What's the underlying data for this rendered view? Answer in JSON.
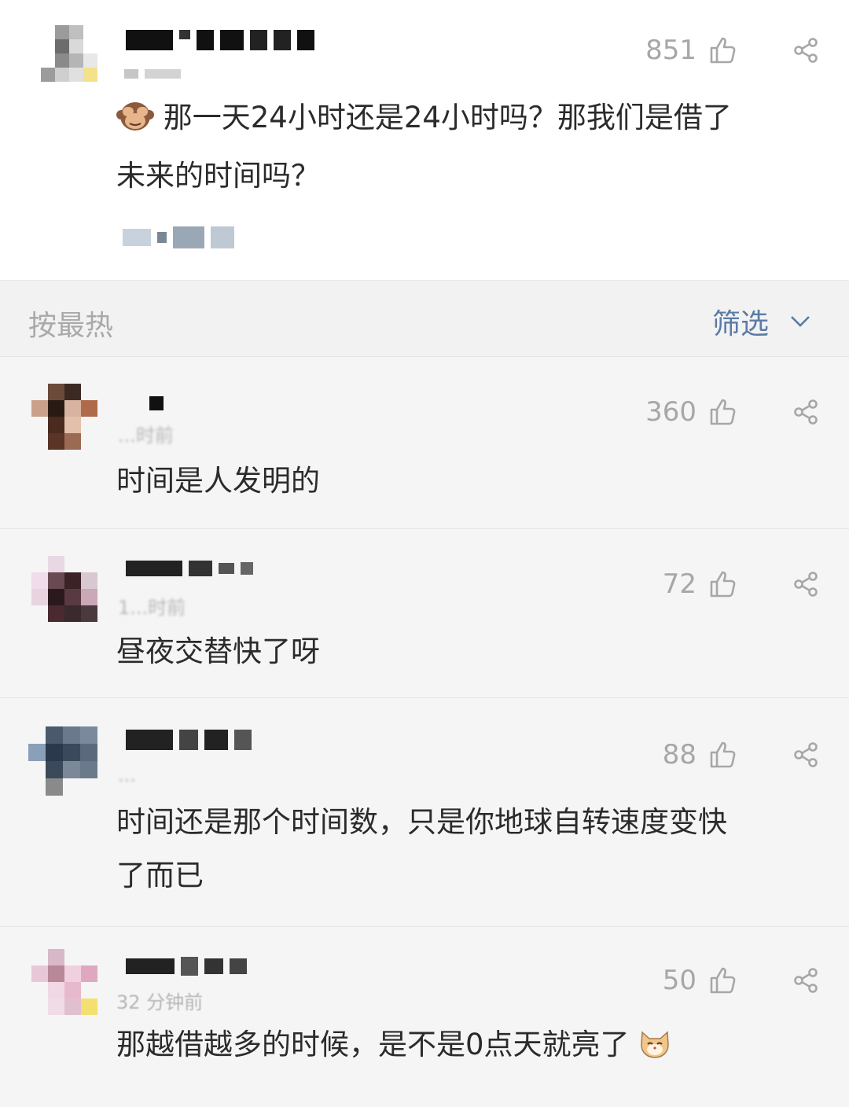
{
  "post": {
    "likes": "851",
    "text_line1": "那一天24小时还是24小时吗？那我们是借了",
    "text_line2": "未来的时间吗？",
    "emoji": "see-no-evil-monkey-icon"
  },
  "sort_bar": {
    "sort_label": "按最热",
    "filter_label": "筛选"
  },
  "comments": [
    {
      "time": "...时前",
      "likes": "360",
      "text": "时间是人发明的"
    },
    {
      "time": "1...时前",
      "likes": "72",
      "text": "昼夜交替快了呀"
    },
    {
      "time": "...",
      "likes": "88",
      "text_line1": "时间还是那个时间数，只是你地球自转速度变快",
      "text_line2": "了而已"
    },
    {
      "time": "32 分钟前",
      "likes": "50",
      "text": "那越借越多的时候，是不是0点天就亮了",
      "emoji": "cat-face-icon"
    }
  ],
  "colors": {
    "accent_filter": "#5a7ba6",
    "like_count": "#a7a7a7",
    "body_text": "#2b2b2b"
  }
}
